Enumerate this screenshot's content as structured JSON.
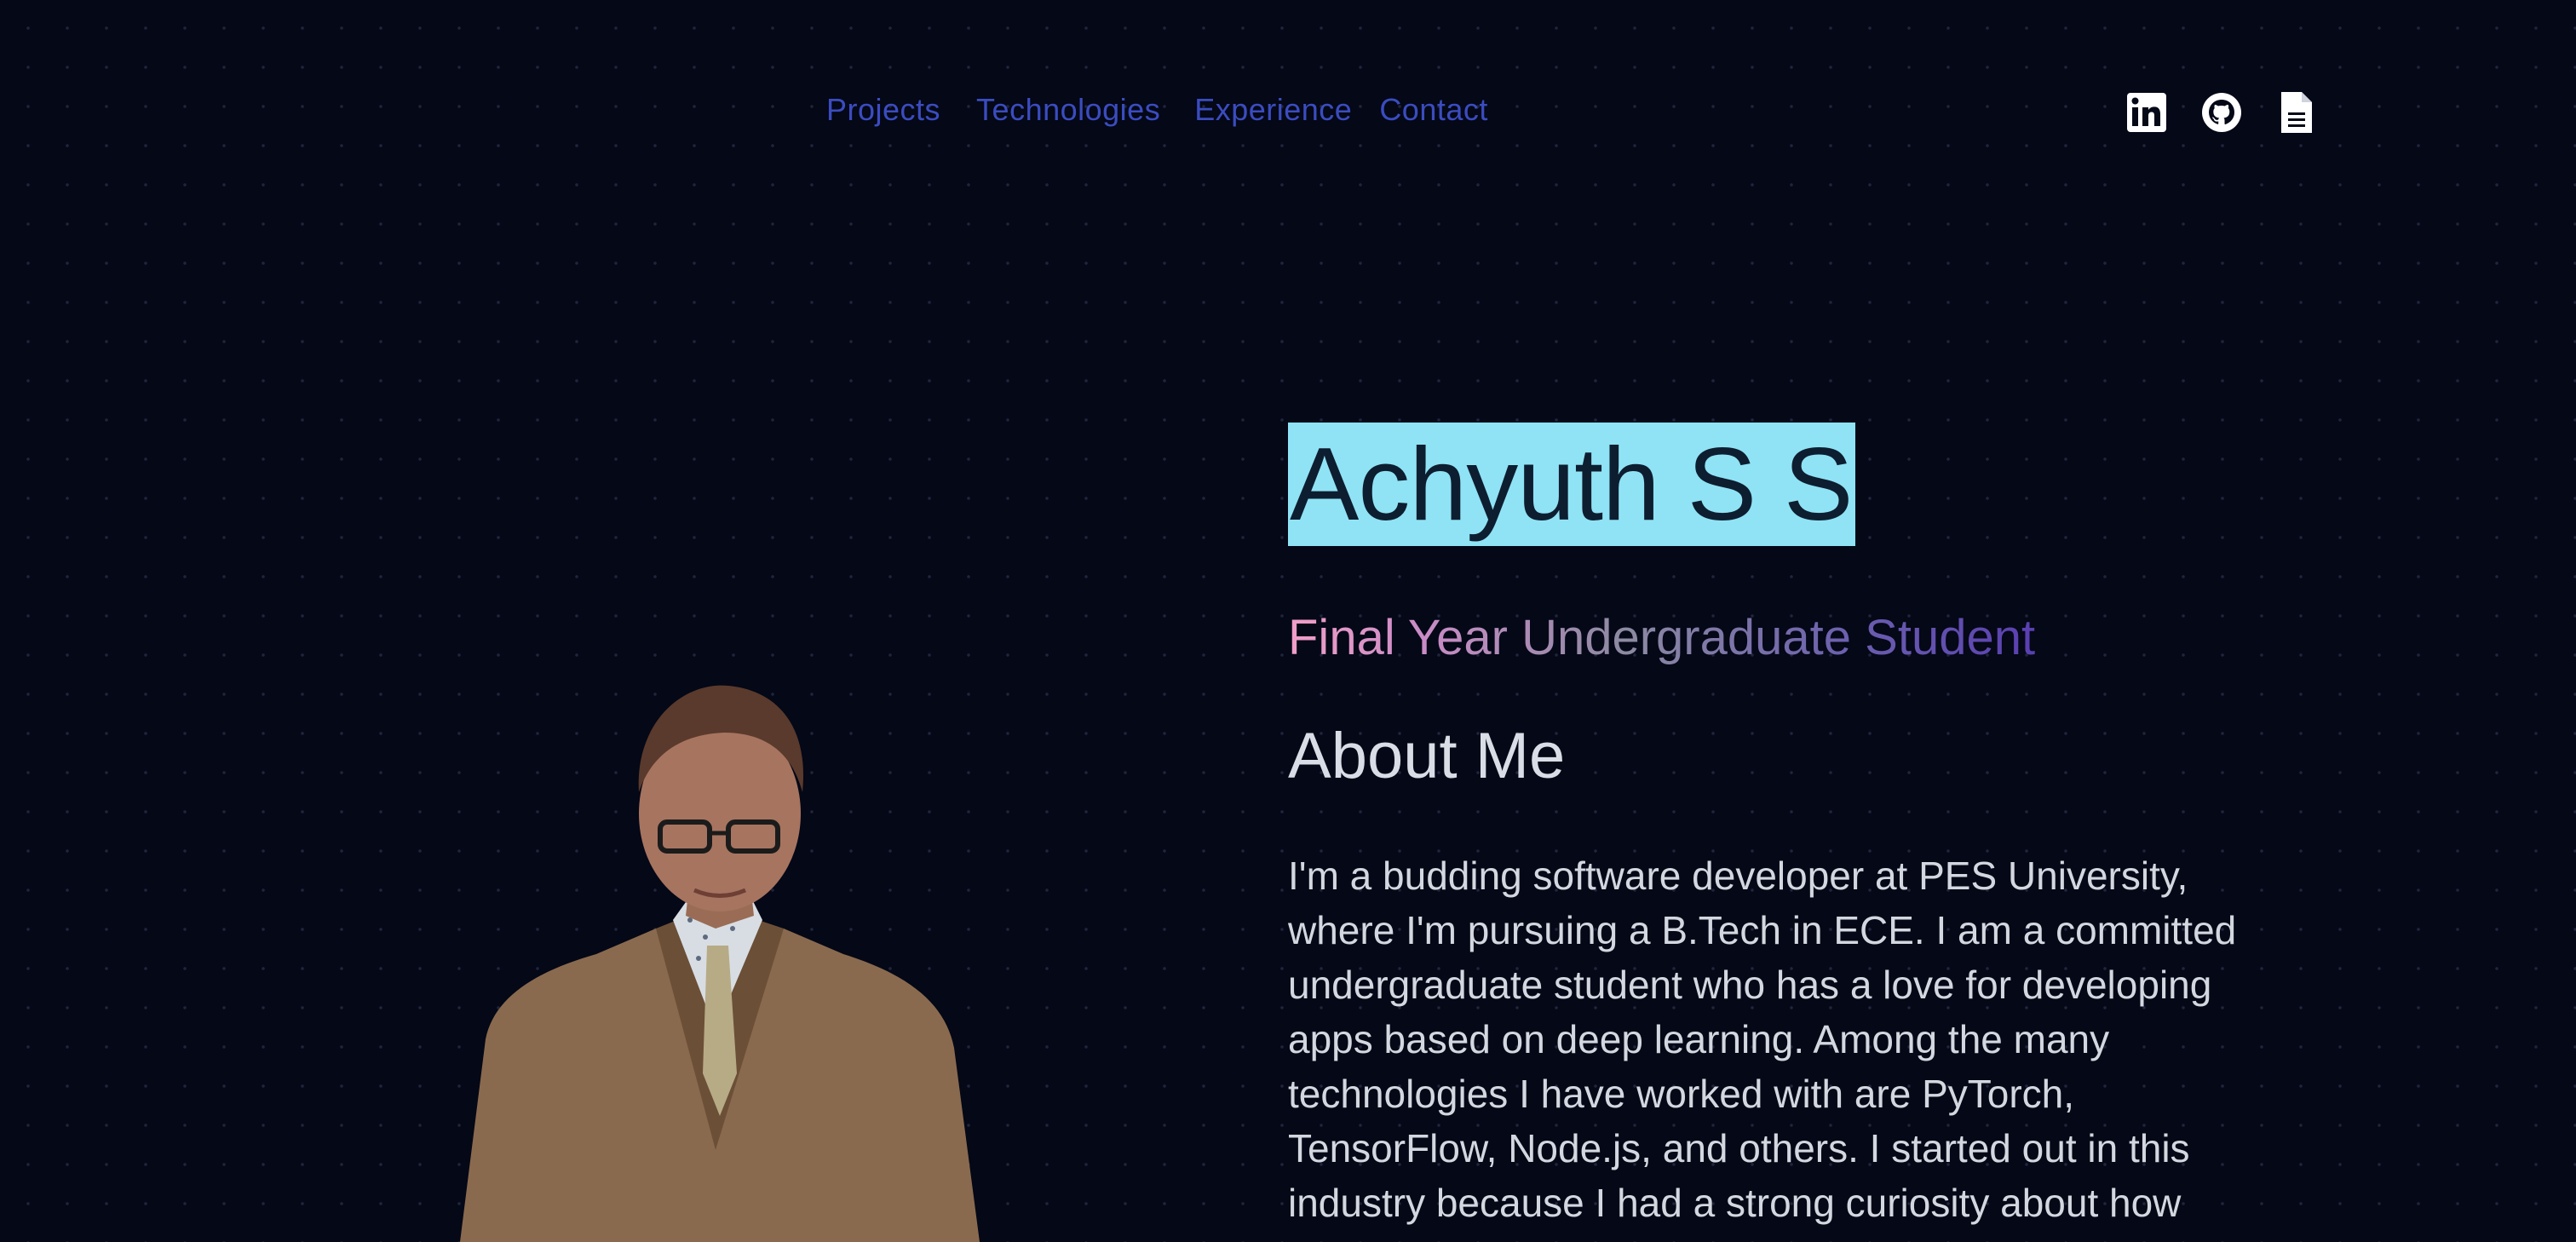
{
  "nav": {
    "links": [
      {
        "label": "Projects"
      },
      {
        "label": "Technologies"
      },
      {
        "label": "Experience"
      },
      {
        "label": "Contact"
      }
    ]
  },
  "socials": {
    "icons": [
      "linkedin-icon",
      "github-icon",
      "resume-file-icon"
    ]
  },
  "hero": {
    "name": "Achyuth S S",
    "subtitle": "Final Year Undergraduate Student",
    "about_heading": "About Me",
    "about_text": "I'm a budding software developer at PES University, where I'm pursuing a B.Tech in ECE. I am a committed undergraduate student who has a love for developing apps based on deep learning. Among the many technologies I have worked with are PyTorch, TensorFlow, Node.js, and others. I started out in this industry because I had a strong curiosity about how"
  },
  "colors": {
    "background": "#040817",
    "nav_link": "#3b4cc0",
    "name_highlight": "#8fe3f5",
    "subtitle_gradient_start": "#f29fc9",
    "subtitle_gradient_end": "#5a3fb0",
    "text": "#d3d7df"
  }
}
